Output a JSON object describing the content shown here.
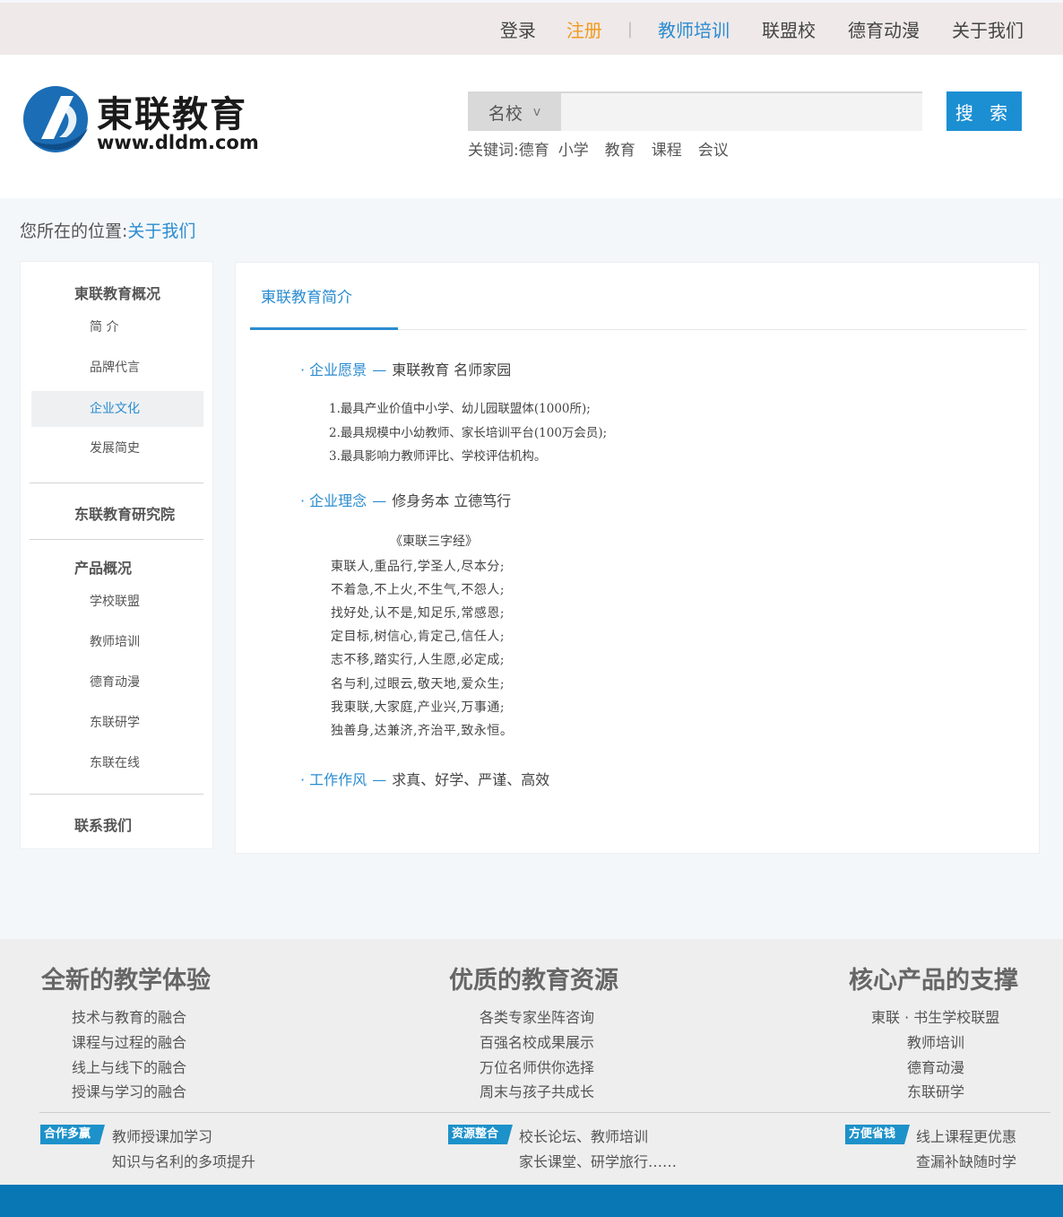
{
  "topnav": {
    "login": "登录",
    "register": "注册",
    "separator": "|",
    "items": [
      "教师培训",
      "联盟校",
      "德育动漫",
      "关于我们"
    ]
  },
  "header": {
    "logo_title": "東联教育",
    "logo_url": "www.dldm.com",
    "search_category": "名校",
    "search_chevron": "v",
    "search_button": "搜 索",
    "keywords_label": "关键词:",
    "keywords": [
      "德育",
      "小学",
      "教育",
      "课程",
      "会议"
    ]
  },
  "breadcrumb": {
    "prefix": "您所在的位置:",
    "current": "关于我们"
  },
  "sidebar": {
    "group1_title": "東联教育概况",
    "group1_items": [
      "简  介",
      "品牌代言",
      "企业文化",
      "发展简史"
    ],
    "group2_title": "东联教育研究院",
    "group3_title": "产品概况",
    "group3_items": [
      "学校联盟",
      "教师培训",
      "德育动漫",
      "东联研学",
      "东联在线"
    ],
    "group4_title": "联系我们"
  },
  "main": {
    "tab": "東联教育简介",
    "vision_label": "· 企业愿景",
    "dash": "—",
    "vision_value": "東联教育  名师家园",
    "vision_list": [
      "1.最具产业价值中小学、幼儿园联盟体(1000所);",
      "2.最具规模中小幼教师、家长培训平台(100万会员);",
      "3.最具影响力教师评比、学校评估机构。"
    ],
    "philosophy_label": "· 企业理念",
    "philosophy_value": "修身务本  立德笃行",
    "poem_title": "《東联三字经》",
    "poem_lines": [
      "東联人,重品行,学圣人,尽本分;",
      "不着急,不上火,不生气,不怨人;",
      "找好处,认不是,知足乐,常感恩;",
      "定目标,树信心,肯定己,信任人;",
      "志不移,踏实行,人生愿,必定成;",
      "名与利,过眼云,敬天地,爱众生;",
      "我東联,大家庭,产业兴,万事通;",
      "独善身,达兼济,齐治平,致永恒。"
    ],
    "style_label": "· 工作作风",
    "style_value": "求真、好学、严谨、高效"
  },
  "footer": {
    "col1": {
      "title": "全新的教学体验",
      "items": [
        "技术与教育的融合",
        "课程与过程的融合",
        "线上与线下的融合",
        "授课与学习的融合"
      ],
      "badge": "合作多赢",
      "lines": [
        "教师授课加学习",
        "知识与名利的多项提升"
      ]
    },
    "col2": {
      "title": "优质的教育资源",
      "items": [
        "各类专家坐阵咨询",
        "百强名校成果展示",
        "万位名师供你选择",
        "周末与孩子共成长"
      ],
      "badge": "资源整合",
      "lines": [
        "校长论坛、教师培训",
        "家长课堂、研学旅行……"
      ]
    },
    "col3": {
      "title": "核心产品的支撑",
      "items": [
        "東联 · 书生学校联盟",
        "教师培训",
        "德育动漫",
        "东联研学"
      ],
      "badge": "方便省钱",
      "lines": [
        "线上课程更优惠",
        "查漏补缺随时学"
      ]
    }
  },
  "colors": {
    "accent": "#2a8cd0",
    "register": "#f09a1c",
    "search_button": "#1c8fd3",
    "bottom_bar": "#0a77b5"
  }
}
